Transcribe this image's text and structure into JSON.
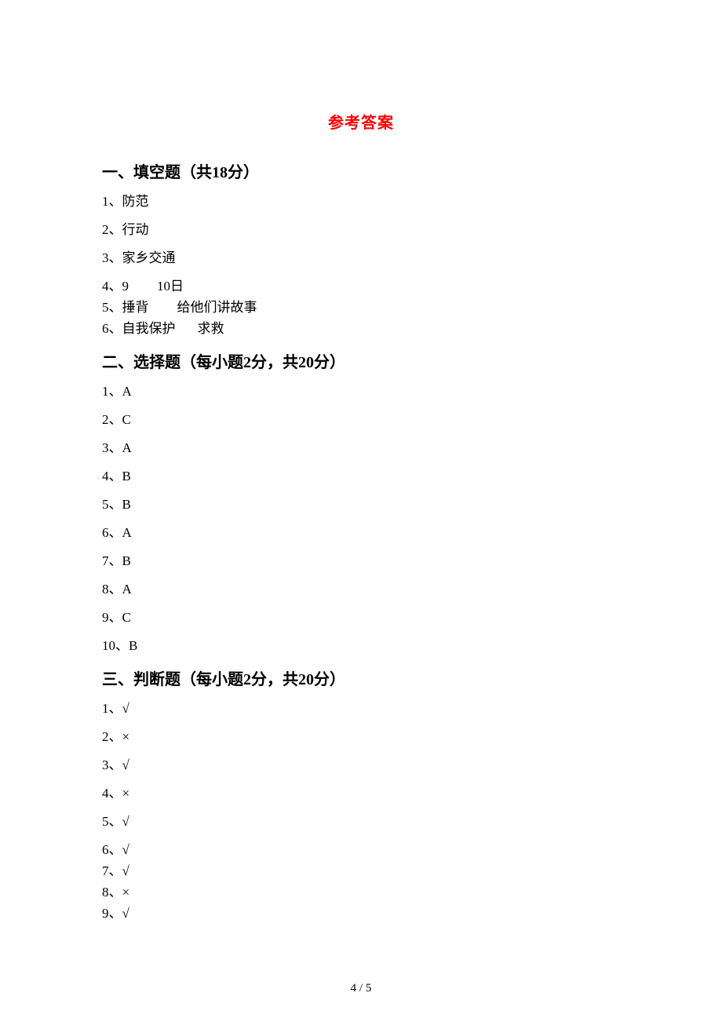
{
  "title": "参考答案",
  "sections": {
    "s1": {
      "header": "一、填空题（共18分）",
      "items": {
        "i1": "1、防范",
        "i2": "2、行动",
        "i3": "3、家乡交通",
        "i4a": "4、9",
        "i4b": "10日",
        "i5a": "5、捶背",
        "i5b": "给他们讲故事",
        "i6a": "6、自我保护",
        "i6b": "求救"
      }
    },
    "s2": {
      "header": "二、选择题（每小题2分，共20分）",
      "items": {
        "i1": "1、A",
        "i2": "2、C",
        "i3": "3、A",
        "i4": "4、B",
        "i5": "5、B",
        "i6": "6、A",
        "i7": "7、B",
        "i8": "8、A",
        "i9": "9、C",
        "i10": "10、B"
      }
    },
    "s3": {
      "header": "三、判断题（每小题2分，共20分）",
      "items": {
        "i1": "1、√",
        "i2": "2、×",
        "i3": "3、√",
        "i4": "4、×",
        "i5": "5、√",
        "i6": "6、√",
        "i7": "7、√",
        "i8": "8、×",
        "i9": "9、√"
      }
    }
  },
  "footer": "4 / 5"
}
